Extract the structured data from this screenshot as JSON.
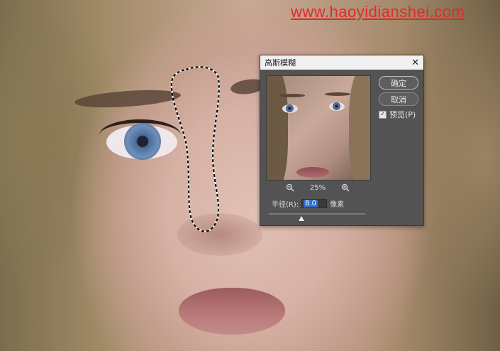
{
  "watermark": {
    "text": "www.haoyidianshei.com"
  },
  "dialog": {
    "title": "高斯模糊",
    "close_icon": "close-icon",
    "buttons": {
      "ok": "确定",
      "cancel": "取消"
    },
    "preview_checkbox": {
      "label": "预览(P)",
      "checked": true
    },
    "zoom": {
      "zoom_out_icon": "zoom-out-icon",
      "level": "25%",
      "zoom_in_icon": "zoom-in-icon"
    },
    "radius": {
      "label": "半径(R):",
      "value": "8.0",
      "unit": "像素"
    },
    "slider": {
      "position_fraction": 0.34
    }
  },
  "colors": {
    "watermark": "#e02a2a",
    "dialog_bg": "#535353",
    "selection_highlight": "#2f6fc9"
  }
}
